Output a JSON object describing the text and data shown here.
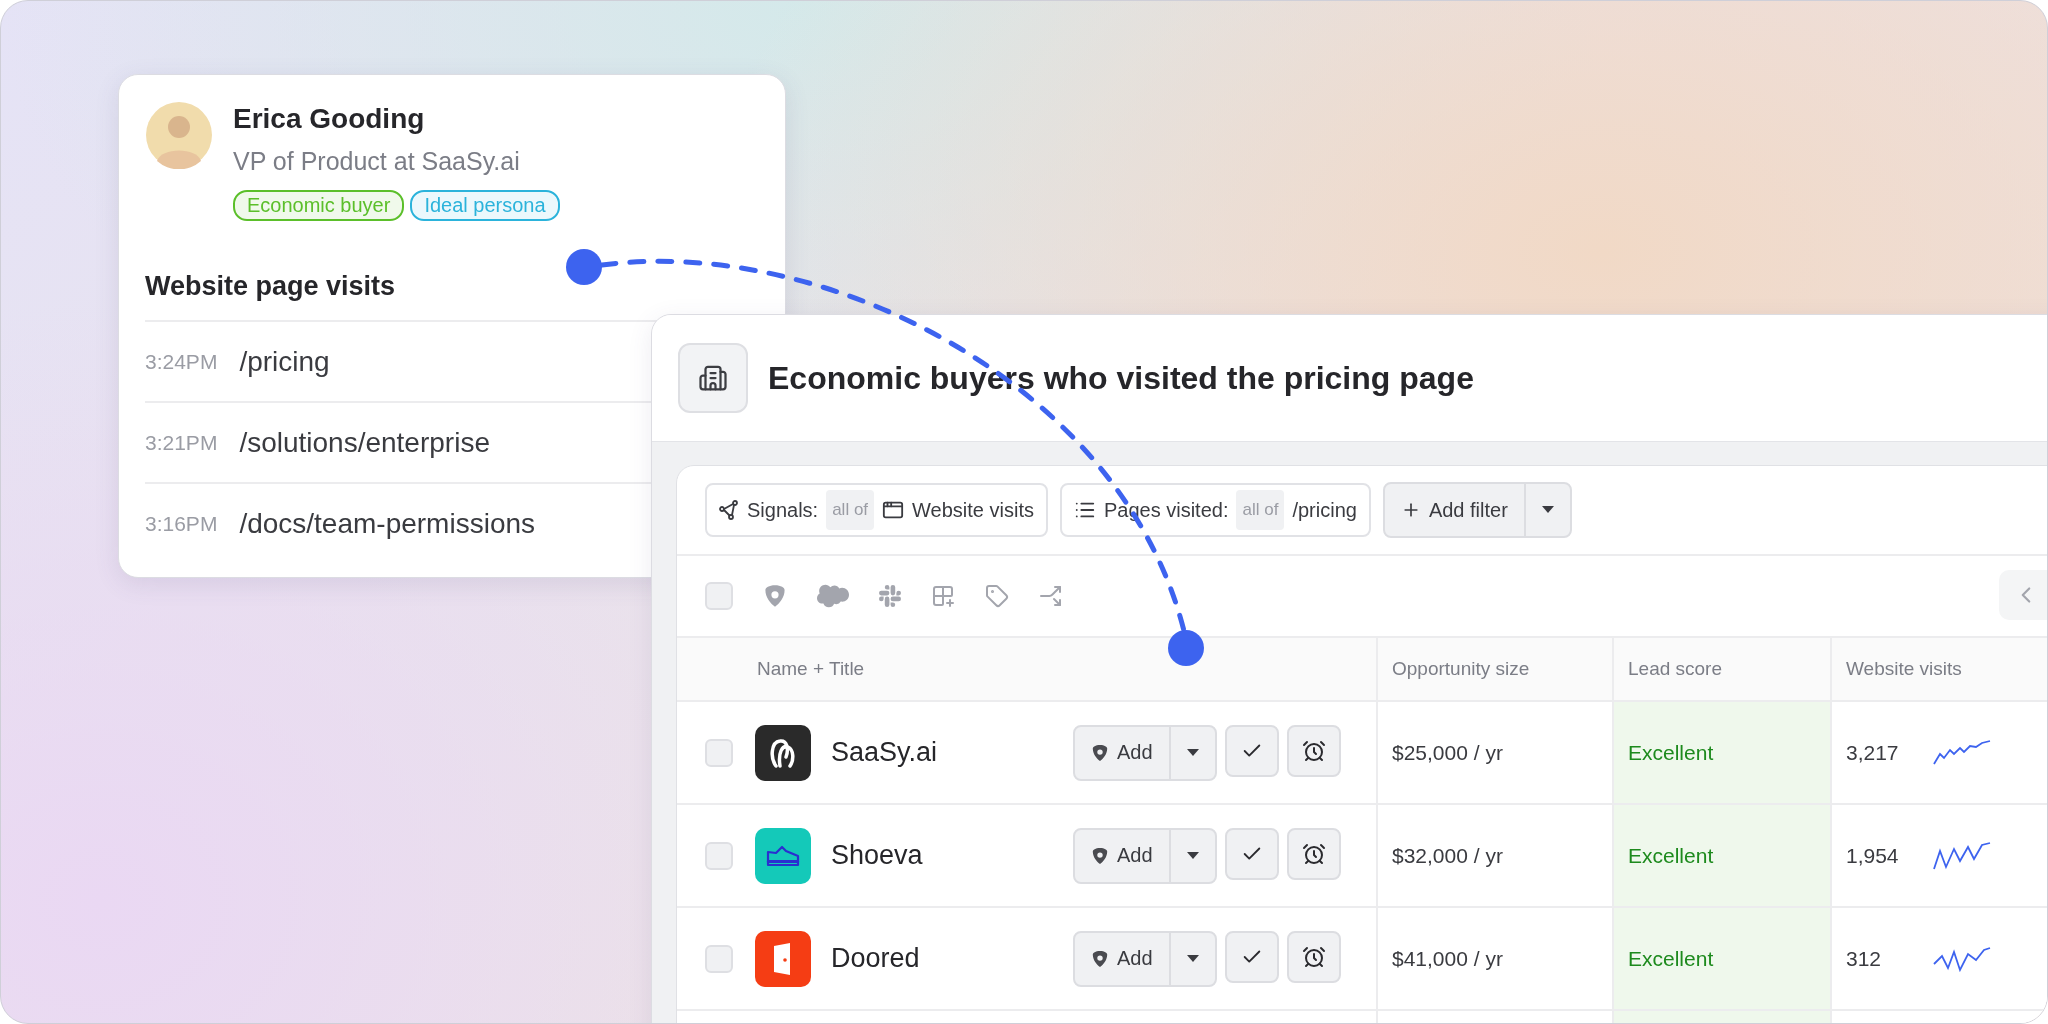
{
  "profile": {
    "name": "Erica Gooding",
    "title": "VP of Product at SaaSy.ai",
    "tags": [
      {
        "label": "Economic buyer",
        "color": "#5bbf2a"
      },
      {
        "label": "Ideal persona",
        "color": "#2bb3db"
      }
    ],
    "visits_heading": "Website page visits",
    "visits": [
      {
        "time": "3:24PM",
        "path": "/pricing"
      },
      {
        "time": "3:21PM",
        "path": "/solutions/enterprise"
      },
      {
        "time": "3:16PM",
        "path": "/docs/team-permissions"
      }
    ]
  },
  "list": {
    "title": "Economic buyers who visited the pricing page",
    "filters": [
      {
        "kind": "signals",
        "label": "Signals:",
        "qualifier": "all of",
        "value": "Website visits"
      },
      {
        "kind": "pages",
        "label": "Pages visited:",
        "qualifier": "all of",
        "value": "/pricing"
      }
    ],
    "add_filter": "Add filter",
    "select_all": {
      "checked": false
    },
    "columns": [
      "Name + Title",
      "Opportunity size",
      "Lead score",
      "Website visits"
    ],
    "rows": [
      {
        "kind": "loop",
        "color": "#2a2a2a",
        "name": "SaaSy.ai",
        "add": "Add",
        "checked": false,
        "opportunity": "$25,000 / yr",
        "lead_score": "Excellent",
        "visits": "3,217"
      },
      {
        "kind": "shoe",
        "color": "#14c9b9",
        "name": "Shoeva",
        "add": "Add",
        "checked": false,
        "opportunity": "$32,000 / yr",
        "lead_score": "Excellent",
        "visits": "1,954"
      },
      {
        "kind": "door",
        "color": "#f53d14",
        "name": "Doored",
        "add": "Add",
        "checked": false,
        "opportunity": "$41,000 / yr",
        "lead_score": "Excellent",
        "visits": "312"
      }
    ]
  }
}
